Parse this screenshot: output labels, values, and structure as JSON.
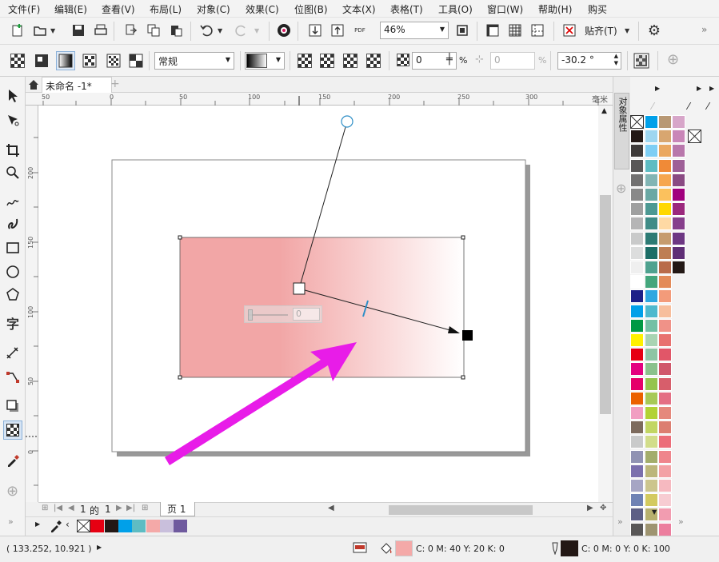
{
  "menu": [
    "文件(F)",
    "编辑(E)",
    "查看(V)",
    "布局(L)",
    "对象(C)",
    "效果(C)",
    "位图(B)",
    "文本(X)",
    "表格(T)",
    "工具(O)",
    "窗口(W)",
    "帮助(H)",
    "购买"
  ],
  "toolbar": {
    "zoom_value": "46%",
    "snap_label": "贴齐(T)",
    "pdf_label": "PDF"
  },
  "propbar": {
    "merge_mode": "常规",
    "transparency_value": "0",
    "transparency_unit": "%",
    "midpoint_value": "0",
    "midpoint_unit": "%",
    "angle_value": "-30.2 °"
  },
  "document": {
    "tab_title": "未命名 -1*"
  },
  "ruler": {
    "h_ticks": [
      "50",
      "0",
      "50",
      "100",
      "150",
      "200",
      "250",
      "300"
    ],
    "v_ticks": [
      "200",
      "150",
      "100",
      "50",
      "0"
    ],
    "unit": "毫米"
  },
  "canvas": {
    "fill_color_start": "#f2a6a6",
    "fill_color_end": "#ffffff",
    "onscreen_slider_value": "0"
  },
  "pagebar": {
    "page_current": "1",
    "page_of": "的",
    "page_total": "1",
    "page_tab": "页 1"
  },
  "docker": {
    "title": "对象属性"
  },
  "status": {
    "coordinates": "( 133.252, 10.921 )",
    "fill_cmyk": "C: 0 M: 40 Y: 20 K: 0",
    "outline_cmyk": "C: 0 M: 0 Y: 0 K: 100",
    "fill_color": "#f4a9a8",
    "outline_color": "#231815"
  },
  "colors": {
    "accent_arrow": "#e81ce8",
    "selection_blue": "#2f8fc7"
  },
  "palette_columns": [
    [
      "none",
      "#231815",
      "#3e3a39",
      "#595757",
      "#727171",
      "#898989",
      "#9fa0a0",
      "#b5b5b6",
      "#c9caca",
      "#dcdddd",
      "#efefef",
      "#ffffff",
      "#1d2088",
      "#00a0e9",
      "#009944",
      "#fff100",
      "#e60012",
      "#e4007f",
      "#e5006a",
      "#eb6100",
      "#f19ec2",
      "#7d6b5d",
      "#c9caca",
      "#9193b3",
      "#7b6fad",
      "#a6a5c4",
      "#6f82b4",
      "#5d5f85",
      "#595757"
    ],
    [
      "#00a0e9",
      "#9ed6f0",
      "#7ecef4",
      "#5ebcc3",
      "#81b5b4",
      "#6aa8a4",
      "#4c9993",
      "#3f8c87",
      "#2d7b74",
      "#1d6e67",
      "#4fa28f",
      "#44a67c",
      "#2ea7e0",
      "#4eb9cd",
      "#74c0a5",
      "#a9d4b3",
      "#8ec5a4",
      "#8bc18c",
      "#95c44e",
      "#a7c957",
      "#b2d235",
      "#c2d663",
      "#d2dd8a",
      "#a3ad6b",
      "#bcb67b",
      "#ccc58d",
      "#d3ca5f",
      "#b7b06e",
      "#9e9470"
    ],
    [
      "#b89874",
      "#d8a670",
      "#eaa760",
      "#f08a37",
      "#f6a64f",
      "#fbc15d",
      "#ffd801",
      "#fed9a4",
      "#c69c6e",
      "#be7e53",
      "#b96b4a",
      "#e38b59",
      "#f39b7a",
      "#f7be9c",
      "#f09288",
      "#e8716f",
      "#e15668",
      "#d0576b",
      "#d75e6b",
      "#e46f84",
      "#e5887c",
      "#dc7e71",
      "#ec6d79",
      "#ef858c",
      "#f3a1a5",
      "#f6b9c0",
      "#f7ccd2",
      "#f29cb0",
      "#ec7e9e"
    ],
    [
      "#d7a6c9",
      "#c986b8",
      "#b877ab",
      "#9e5f97",
      "#8a4a83",
      "#a1007d",
      "#9b287d",
      "#873f8c",
      "#6d3783",
      "#5f2e76",
      "#231815",
      "none",
      "none",
      "none",
      "none",
      "none",
      "none",
      "none",
      "none",
      "none",
      "none",
      "none",
      "none",
      "none",
      "none",
      "none",
      "none",
      "none",
      "none"
    ]
  ],
  "bottom_palette": [
    "none",
    "#e60012",
    "#231815",
    "#00a0e9",
    "#5ebcc3",
    "#f4a9a8",
    "#c9bfdc",
    "#6f5a9e"
  ]
}
